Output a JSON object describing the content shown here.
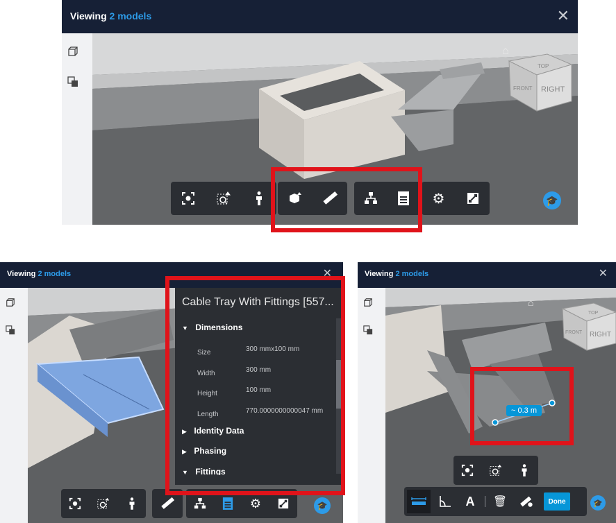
{
  "header": {
    "viewing_label": "Viewing",
    "models_count": "2 models"
  },
  "viewcube": {
    "top": "TOP",
    "front": "FRONT",
    "right": "RIGHT"
  },
  "properties": {
    "title": "Cable Tray With Fittings [557...",
    "sections": {
      "dimensions": "Dimensions",
      "identity": "Identity Data",
      "phasing": "Phasing",
      "fittings": "Fittings"
    },
    "rows": [
      {
        "k": "Size",
        "v": "300 mmx100 mm"
      },
      {
        "k": "Width",
        "v": "300 mm"
      },
      {
        "k": "Height",
        "v": "100 mm"
      },
      {
        "k": "Length",
        "v": "770.0000000000047 mm"
      }
    ]
  },
  "measure": {
    "value": "~ 0.3 m",
    "done_label": "Done"
  },
  "colors": {
    "header": "#162036",
    "accent": "#2d9be8",
    "highlight": "#e0131a",
    "toolbar": "#2b2e33"
  },
  "icons": [
    "fit-view-icon",
    "zoom-window-icon",
    "first-person-icon",
    "section-box-icon",
    "measure-icon",
    "model-browser-icon",
    "properties-icon",
    "settings-icon",
    "fullscreen-icon",
    "home-icon",
    "help-icon",
    "cube-icon",
    "layers-icon",
    "distance-icon",
    "angle-icon",
    "annotation-icon",
    "trash-icon",
    "measure-settings-icon"
  ]
}
